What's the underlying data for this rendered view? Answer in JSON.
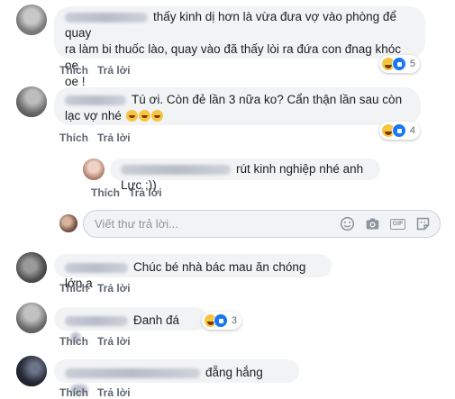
{
  "thread": {
    "comments": [
      {
        "text": "thấy kinh dị hơn là vừa đưa vợ vào phòng để quay ra làm bi thuốc lào, quay vào đã thấy lòi ra đứa con đnag khóc oe oe !",
        "line1": "thấy kinh dị hơn là vừa đưa vợ vào phòng để quay",
        "line2": "ra làm bi thuốc lào, quay vào đã thấy lòi ra đứa con đnag khóc oe",
        "line3": "oe !",
        "like_label": "Thích",
        "reply_label": "Trả lời",
        "reaction_count": "5"
      },
      {
        "text": "Tú ơi. Còn đẻ lần 3 nữa ko? Cẩn thận lần sau còn lạc vợ nhé 🤣🤣🤣",
        "line1": "Tú ơi. Còn đẻ lần 3 nữa ko? Cẩn thận lần sau còn",
        "line2": "lạc vợ nhé",
        "like_label": "Thích",
        "reply_label": "Trả lời",
        "reaction_count": "4"
      },
      {
        "text": "rút kinh nghiệp nhé anh Lực ;))",
        "like_label": "Thích",
        "reply_label": "Trả lời"
      },
      {
        "text": "Chúc bé nhà bác mau ăn chóng lớn ạ",
        "like_label": "Thích",
        "reply_label": "Trả lời"
      },
      {
        "text": "Đanh đá",
        "like_label": "Thích",
        "reply_label": "Trả lời",
        "reaction_count": "3"
      },
      {
        "text": "đẵng hắng",
        "like_label": "Thích",
        "reply_label": "Trả lời"
      }
    ]
  },
  "reply_box": {
    "placeholder": "Viết thư trả lời...",
    "icons": [
      "smiley-icon",
      "camera-icon",
      "gif-icon",
      "sticker-icon"
    ]
  },
  "colors": {
    "bubble": "#f2f3f5",
    "action_text": "#606770",
    "placeholder": "#90949c",
    "haha_yellow": "#f7c542",
    "like_blue": "#1877f2"
  }
}
